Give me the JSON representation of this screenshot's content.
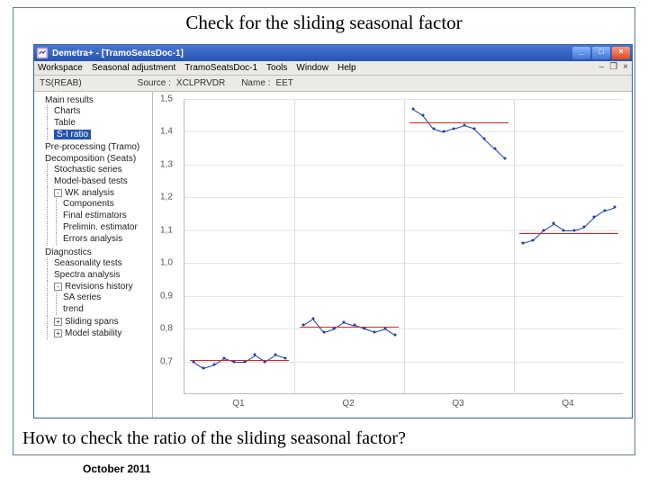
{
  "slide": {
    "title": "Check for the sliding seasonal factor",
    "question": "How to check the ratio of the sliding seasonal factor?",
    "date": "October 2011"
  },
  "app": {
    "window_title": "Demetra+ - [TramoSeatsDoc-1]",
    "menu": [
      "Workspace",
      "Seasonal adjustment",
      "TramoSeatsDoc-1",
      "Tools",
      "Window",
      "Help"
    ],
    "mdi_ctrls": {
      "min": "–",
      "restore": "❐",
      "close": "×"
    },
    "toolbar": {
      "ts_label": "TS(REAB)",
      "source_label": "Source :",
      "source_value": "XCLPRVDR",
      "name_label": "Name :",
      "name_value": "EET"
    },
    "win_btns": {
      "min": "_",
      "max": "□",
      "close": "×"
    }
  },
  "tree": {
    "main": "Main results",
    "charts": "Charts",
    "table": "Table",
    "si": "S-I ratio",
    "preproc": "Pre-processing (Tramo)",
    "decomp": "Decomposition (Seats)",
    "stoch": "Stochastic series",
    "model": "Model-based tests",
    "wk": "WK analysis",
    "components": "Components",
    "finalest": "Final estimators",
    "prelim": "Prelimin. estimator",
    "erran": "Errors analysis",
    "diag": "Diagnostics",
    "seastests": "Seasonality tests",
    "spectra": "Spectra analysis",
    "revhist": "Revisions history",
    "saseries": "SA series",
    "trend": "trend",
    "spans": "Sliding spans",
    "stability": "Model stability"
  },
  "chart_data": {
    "type": "line",
    "ylim": [
      0.6,
      1.5
    ],
    "yticks": [
      0.7,
      0.8,
      0.9,
      1.0,
      1.1,
      1.2,
      1.3,
      1.4,
      1.5
    ],
    "categories": [
      "Q1",
      "Q2",
      "Q3",
      "Q4"
    ],
    "series": [
      {
        "category": "Q1",
        "values": [
          0.7,
          0.68,
          0.69,
          0.71,
          0.7,
          0.7,
          0.72,
          0.7,
          0.72,
          0.71
        ],
        "mean": 0.705
      },
      {
        "category": "Q2",
        "values": [
          0.81,
          0.83,
          0.79,
          0.8,
          0.82,
          0.81,
          0.8,
          0.79,
          0.8,
          0.78
        ],
        "mean": 0.805
      },
      {
        "category": "Q3",
        "values": [
          1.47,
          1.45,
          1.41,
          1.4,
          1.41,
          1.42,
          1.41,
          1.38,
          1.35,
          1.32
        ],
        "mean": 1.43
      },
      {
        "category": "Q4",
        "values": [
          1.06,
          1.07,
          1.1,
          1.12,
          1.1,
          1.1,
          1.11,
          1.14,
          1.16,
          1.17
        ],
        "mean": 1.09
      }
    ],
    "title": "",
    "xlabel": "",
    "ylabel": ""
  }
}
